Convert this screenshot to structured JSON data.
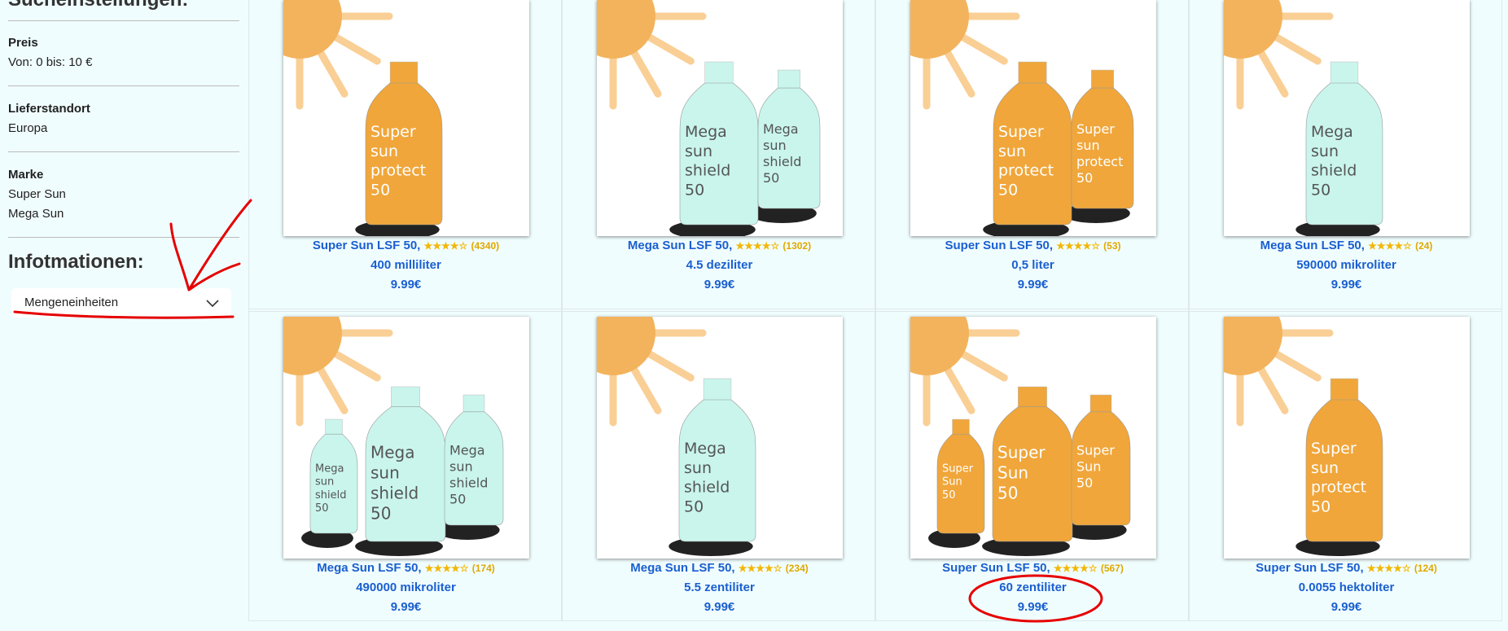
{
  "sidebar": {
    "title": "Sucheinstellungen:",
    "price_label": "Preis",
    "price_value": "Von: 0 bis: 10 €",
    "location_label": "Lieferstandort",
    "location_value": "Europa",
    "brand_label": "Marke",
    "brand_values": [
      "Super Sun",
      "Mega Sun"
    ],
    "info_title": "Infotmationen:",
    "select_value": "Mengeneinheiten"
  },
  "colors": {
    "orange": "#f0a63a",
    "mint": "#c9f5ec",
    "link": "#1a5fd0",
    "annotation": "#e60000"
  },
  "products": [
    {
      "name": "Super Sun LSF 50,",
      "stars": "★★★★☆",
      "count": "(4340)",
      "amount": "400 milliliter",
      "price": "9.99€",
      "brand": "super",
      "bottles": [
        {
          "lines": [
            "Super",
            "sun",
            "protect",
            "50"
          ]
        }
      ]
    },
    {
      "name": "Mega Sun LSF 50,",
      "stars": "★★★★☆",
      "count": "(1302)",
      "amount": "4.5 deziliter",
      "price": "9.99€",
      "brand": "mega",
      "bottles": [
        {
          "lines": [
            "Mega",
            "sun",
            "shield",
            "50"
          ]
        },
        {
          "lines": [
            "Mega",
            "sun",
            "shield",
            "50"
          ]
        }
      ]
    },
    {
      "name": "Super Sun LSF 50,",
      "stars": "★★★★☆",
      "count": "(53)",
      "amount": "0,5 liter",
      "price": "9.99€",
      "brand": "super",
      "bottles": [
        {
          "lines": [
            "Super",
            "sun",
            "protect",
            "50"
          ]
        },
        {
          "lines": [
            "Super",
            "sun",
            "protect",
            "50"
          ]
        }
      ]
    },
    {
      "name": "Mega Sun LSF 50,",
      "stars": "★★★★☆",
      "count": "(24)",
      "amount": "590000 mikroliter",
      "price": "9.99€",
      "brand": "mega",
      "bottles": [
        {
          "lines": [
            "Mega",
            "sun",
            "shield",
            "50"
          ]
        }
      ]
    },
    {
      "name": "Mega Sun LSF 50,",
      "stars": "★★★★☆",
      "count": "(174)",
      "amount": "490000 mikroliter",
      "price": "9.99€",
      "brand": "mega",
      "bottles": [
        {
          "lines": [
            "Mega",
            "sun",
            "shield",
            "50"
          ]
        },
        {
          "lines": [
            "Mega",
            "sun",
            "shield",
            "50"
          ]
        },
        {
          "lines": [
            "Mega",
            "sun",
            "shield",
            "50"
          ]
        }
      ]
    },
    {
      "name": "Mega Sun LSF 50,",
      "stars": "★★★★☆",
      "count": "(234)",
      "amount": "5.5 zentiliter",
      "price": "9.99€",
      "brand": "mega",
      "bottles": [
        {
          "lines": [
            "Mega",
            "sun",
            "shield",
            "50"
          ]
        }
      ]
    },
    {
      "name": "Super Sun LSF 50,",
      "stars": "★★★★☆",
      "count": "(567)",
      "amount": "60 zentiliter",
      "price": "9.99€",
      "brand": "super",
      "bottles": [
        {
          "lines": [
            "Super",
            "Sun",
            "50"
          ]
        },
        {
          "lines": [
            "Super",
            "Sun",
            "50"
          ]
        },
        {
          "lines": [
            "Super",
            "Sun",
            "50"
          ]
        }
      ]
    },
    {
      "name": "Super Sun LSF 50,",
      "stars": "★★★★☆",
      "count": "(124)",
      "amount": "0.0055 hektoliter",
      "price": "9.99€",
      "brand": "super",
      "bottles": [
        {
          "lines": [
            "Super",
            "sun",
            "protect",
            "50"
          ]
        }
      ]
    }
  ]
}
